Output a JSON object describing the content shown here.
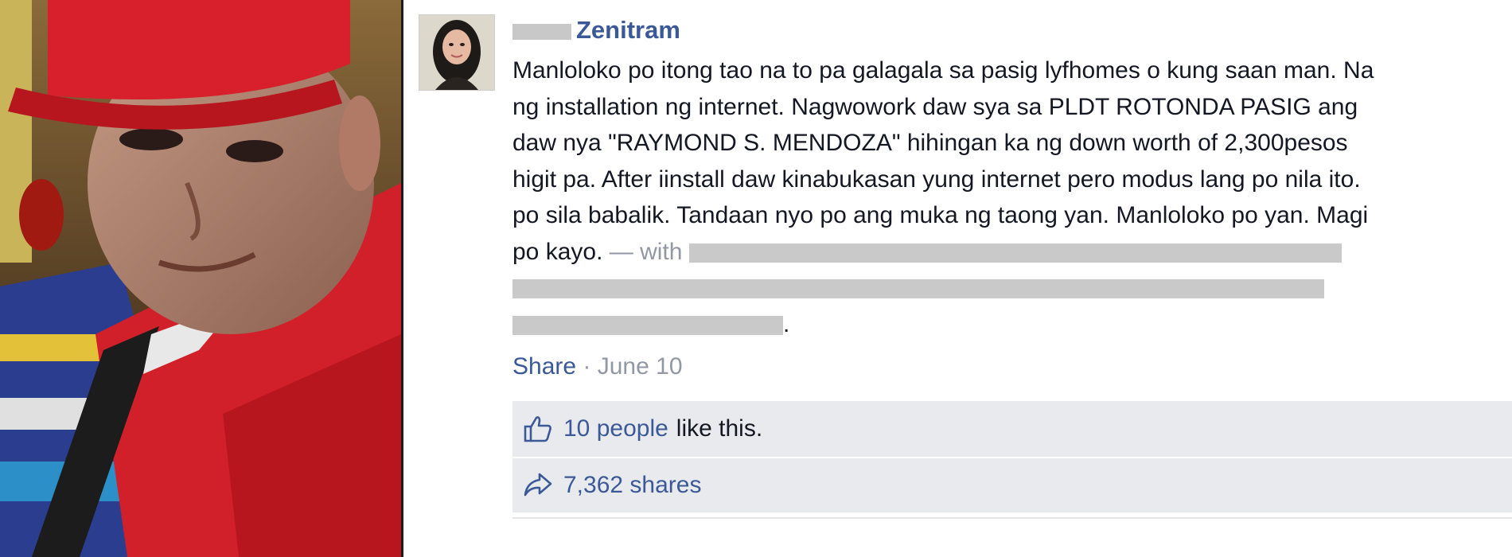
{
  "post": {
    "author": {
      "first_name_redacted": true,
      "last_name": "Zenitram"
    },
    "body_lines": [
      "Manloloko po itong tao na to pa galagala sa pasig lyfhomes o kung saan man. Na",
      "ng installation ng internet. Nagwowork daw sya sa PLDT ROTONDA PASIG ang",
      "daw nya \"RAYMOND S. MENDOZA\" hihingan ka ng down worth of 2,300pesos",
      "higit pa. After iinstall daw kinabukasan yung internet pero modus lang po nila ito.",
      "po sila babalik. Tandaan nyo po ang muka ng taong yan. Manloloko po yan. Magi"
    ],
    "closing_text": "po kayo.",
    "with_text": "— with",
    "tag_period": ".",
    "actions": {
      "share_label": "Share",
      "separator": "·",
      "date": "June 10"
    },
    "likes": {
      "people_label": "10 people",
      "suffix": "like this."
    },
    "shares": {
      "count_label": "7,362 shares"
    }
  },
  "icons": {
    "like": "thumbs-up-icon",
    "share": "share-arrow-icon"
  },
  "colors": {
    "link": "#3b5998",
    "muted": "#9197a3",
    "feedback_bg": "#e9eaed",
    "text": "#141823"
  }
}
